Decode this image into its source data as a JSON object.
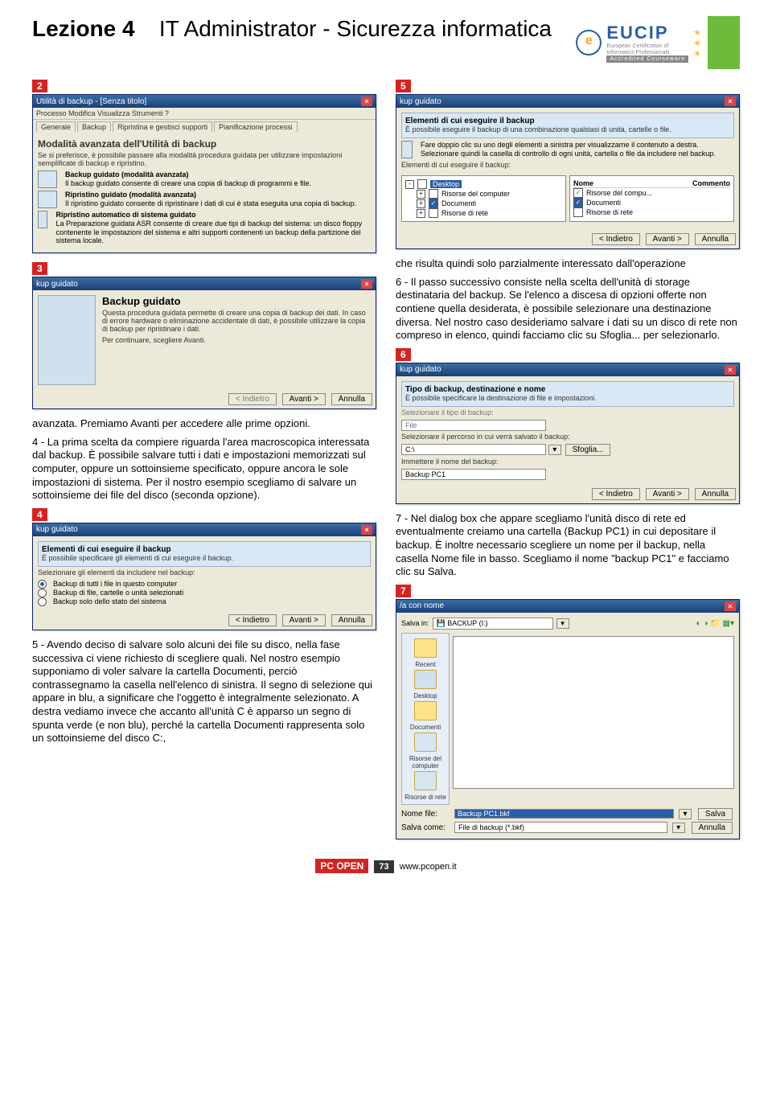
{
  "header": {
    "left": "Lezione 4",
    "center": "IT Administrator - Sicurezza informatica",
    "brand": "EUCIP",
    "brand_sub1": "European Certification of",
    "brand_sub2": "Informatics Professionals",
    "brand_acc": "Accredited Courseware"
  },
  "badges": {
    "n2": "2",
    "n3": "3",
    "n4": "4",
    "n5": "5",
    "n6": "6",
    "n7": "7"
  },
  "win2": {
    "title": "Utilità di backup - [Senza titolo]",
    "menu": "Processo   Modifica   Visualizza   Strumenti   ?",
    "tabs": [
      "Generale",
      "Backup",
      "Ripristina e gestisci supporti",
      "Pianificazione processi"
    ],
    "heading": "Modalità avanzata dell'Utilità di backup",
    "intro": "Se si preferisce, è possibile passare alla modalità procedura guidata per utilizzare impostazioni semplificate di backup e ripristino.",
    "i1t": "Backup guidato (modalità avanzata)",
    "i1d": "Il backup guidato consente di creare una copia di backup di programmi e file.",
    "i2t": "Ripristino guidato (modalità avanzata)",
    "i2d": "Il ripristino guidato consente di ripristinare i dati di cui è stata eseguita una copia di backup.",
    "i3t": "Ripristino automatico di sistema guidato",
    "i3d": "La Preparazione guidata ASR consente di creare due tipi di backup del sistema: un disco floppy contenente le impostazioni del sistema e altri supporti contenenti un backup della partizione del sistema locale."
  },
  "win3": {
    "title": "kup guidato",
    "h": "Backup guidato",
    "p1": "Questa procedura guidata permette di creare una copia di backup dei dati. In caso di errore hardware o eliminazione accidentale di dati, è possibile utilizzare la copia di backup per ripristinare i dati.",
    "p2": "Per continuare, scegliere Avanti.",
    "back": "< Indietro",
    "next": "Avanti >",
    "cancel": "Annulla"
  },
  "win4": {
    "title": "kup guidato",
    "h": "Elementi di cui eseguire il backup",
    "sub": "È possibile specificare gli elementi di cui eseguire il backup.",
    "lbl": "Selezionare gli elementi da includere nel backup:",
    "r1": "Backup di tutti i file in questo computer",
    "r2": "Backup di file, cartelle o unità selezionati",
    "r3": "Backup solo dello stato del sistema",
    "back": "< Indietro",
    "next": "Avanti >",
    "cancel": "Annulla"
  },
  "win5": {
    "title": "kup guidato",
    "h": "Elementi di cui eseguire il backup",
    "sub": "È possibile eseguire il backup di una combinazione qualsiasi di unità, cartelle o file.",
    "instr": "Fare doppio clic su uno degli elementi a sinistra per visualizzarne il contenuto a destra. Selezionare quindi la casella di controllo di ogni unità, cartella o file da includere nel backup.",
    "lbl": "Elementi di cui eseguire il backup:",
    "tree_root": "Desktop",
    "tree1": "Risorse del computer",
    "tree2": "Documenti",
    "tree3": "Risorse di rete",
    "colN": "Nome",
    "colC": "Commento",
    "r1": "Risorse del compu...",
    "r2": "Documenti",
    "r3": "Risorse di rete",
    "back": "< Indietro",
    "next": "Avanti >",
    "cancel": "Annulla"
  },
  "win6": {
    "title": "kup guidato",
    "h": "Tipo di backup, destinazione e nome",
    "sub": "È possibile specificare la destinazione di file e impostazioni.",
    "lbl1": "Selezionare il tipo di backup:",
    "val1": "File",
    "lbl2": "Selezionare il percorso in cui verrà salvato il backup:",
    "val2": "C:\\",
    "browse": "Sfoglia...",
    "lbl3": "Immettere il nome del backup:",
    "val3": "Backup PC1",
    "back": "< Indietro",
    "next": "Avanti >",
    "cancel": "Annulla"
  },
  "win7": {
    "title": "/a con nome",
    "salvain": "Salva in:",
    "drive": "BACKUP (I:)",
    "side": [
      "Recent",
      "Desktop",
      "Documenti",
      "Risorse del computer",
      "Risorse di rete"
    ],
    "namef": "Nome file:",
    "namev": "Backup PC1.bkf",
    "typef": "Salva come:",
    "typev": "File di backup (*.bkf)",
    "save": "Salva",
    "cancel": "Annulla"
  },
  "text": {
    "p_avanzata": "avanzata. Premiamo Avanti per accedere alle prime opzioni.",
    "p4": "4 - La prima scelta da compiere riguarda l'area macroscopica interessata dal backup. È possibile salvare tutti i dati e impostazioni memorizzati sul computer, oppure un sottoinsieme specificato, oppure ancora le sole impostazioni di sistema. Per il nostro esempio scegliamo di salvare un sottoinsieme dei file del disco (seconda opzione).",
    "p5": "5 - Avendo deciso di salvare solo alcuni dei file su disco, nella fase successiva ci viene richiesto di scegliere quali. Nel nostro esempio supponiamo di voler salvare la cartella Documenti, perciò contrassegnamo la casella nell'elenco di sinistra. Il segno di selezione qui appare in blu, a significare che l'oggetto è integralmente selezionato. A destra vediamo invece che accanto all'unità C è apparso un segno di spunta verde (e non blu), perché la cartella Documenti rappresenta solo un sottoinsieme del disco C:,",
    "p6a": "che risulta quindi solo parzialmente interessato dall'operazione",
    "p6b": "6 - Il passo successivo consiste nella scelta dell'unità di storage destinataria del backup. Se l'elenco a discesa di opzioni offerte non contiene quella desiderata, è possibile selezionare una destinazione diversa. Nel nostro caso desideriamo salvare i dati su un disco di rete non compreso in elenco, quindi facciamo clic su Sfoglia... per selezionarlo.",
    "p7": "7 - Nel dialog box che appare scegliamo l'unità disco di rete ed eventualmente creiamo una cartella (Backup PC1) in cui depositare il backup. È inoltre necessario scegliere un nome per il backup, nella casella Nome file in basso. Scegliamo il nome \"backup PC1\" e facciamo clic su Salva."
  },
  "footer": {
    "brand": "PC OPEN",
    "page": "73",
    "url": "www.pcopen.it"
  }
}
